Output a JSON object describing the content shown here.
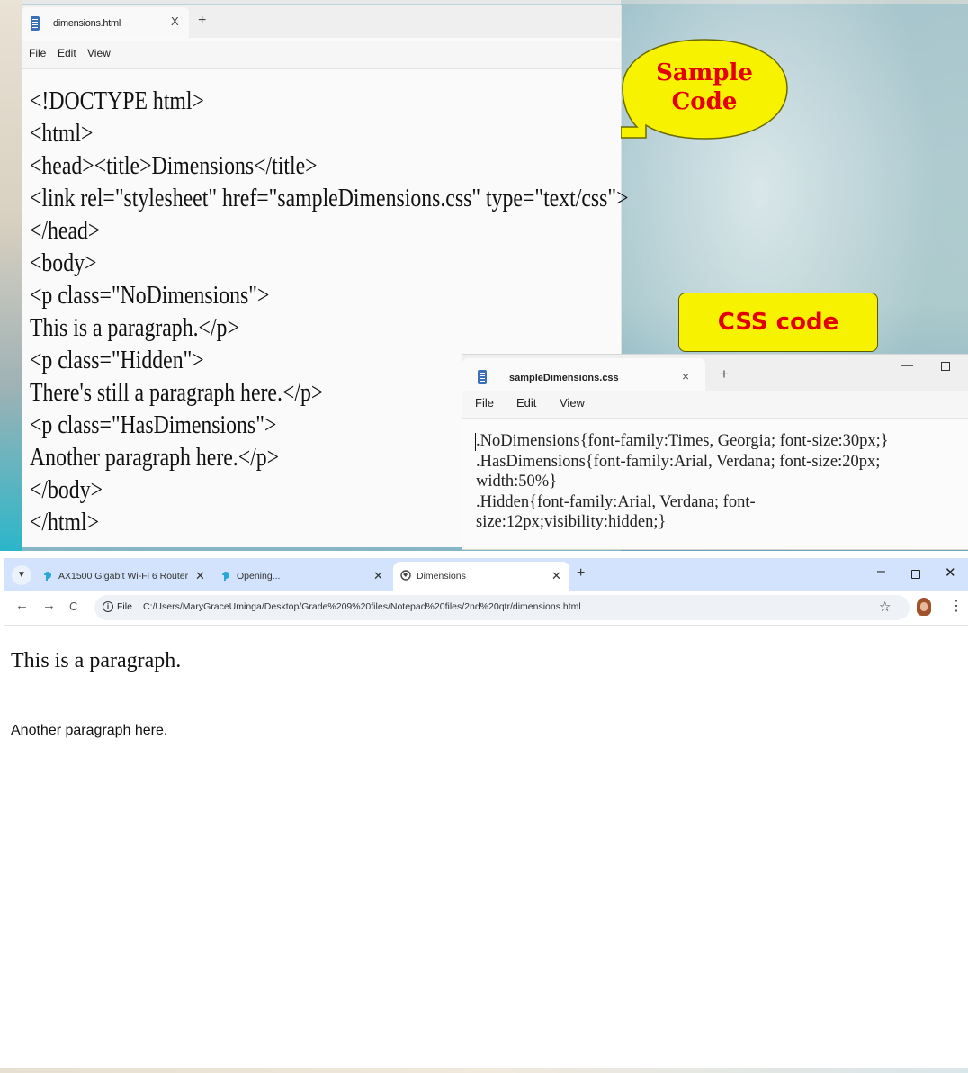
{
  "notepad_html": {
    "tab_title": "dimensions.html",
    "close_label": "X",
    "new_tab_label": "+",
    "menu": [
      "File",
      "Edit",
      "View"
    ],
    "code_lines": [
      "<!DOCTYPE html>",
      "<html>",
      "<head><title>Dimensions</title>",
      "<link rel=\"stylesheet\" href=\"sampleDimensions.css\" type=\"text/css\">",
      "</head>",
      "<body>",
      "<p class=\"NoDimensions\">",
      "This is a paragraph.</p>",
      "<p class=\"Hidden\">",
      "There's still a paragraph here.</p>",
      "<p class=\"HasDimensions\">",
      "Another paragraph here.</p>",
      "</body>",
      "</html>"
    ]
  },
  "callouts": {
    "sample_code": "Sample\nCode",
    "css_code": "CSS code",
    "bubble_color": "#f7f200",
    "text_color": "#e40000"
  },
  "notepad_css": {
    "tab_title": "sampleDimensions.css",
    "close_label": "×",
    "new_tab_label": "+",
    "minimize_label": "—",
    "menu": [
      "File",
      "Edit",
      "View"
    ],
    "code": ".NoDimensions{font-family:Times, Georgia; font-size:30px;}\n.HasDimensions{font-family:Arial, Verdana; font-size:20px;\nwidth:50%}\n.Hidden{font-family:Arial, Verdana; font-\nsize:12px;visibility:hidden;}"
  },
  "browser": {
    "tabs": [
      {
        "title": "AX1500 Gigabit Wi-Fi 6 Router",
        "close": "✕"
      },
      {
        "title": "Opening...",
        "close": "✕"
      },
      {
        "title": "Dimensions",
        "close": "✕"
      }
    ],
    "new_tab": "+",
    "window_min": "–",
    "window_close": "✕",
    "nav_back": "←",
    "nav_forward": "→",
    "nav_reload": "C",
    "url_chip": "File",
    "url": "C:/Users/MaryGraceUminga/Desktop/Grade%209%20files/Notepad%20files/2nd%20qtr/dimensions.html",
    "bookmark_icon": "star-icon",
    "page": {
      "paragraph1": "This is a paragraph.",
      "paragraph3": "Another paragraph here."
    },
    "tab_strip_color": "#d3e3fd"
  }
}
